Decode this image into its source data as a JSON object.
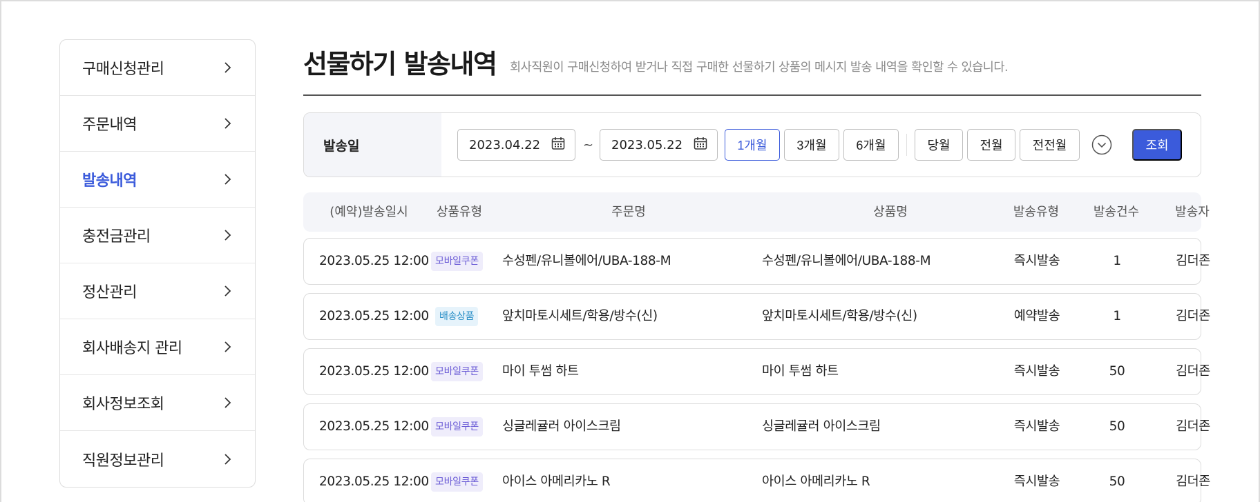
{
  "sidebar": {
    "items": [
      {
        "label": "구매신청관리",
        "active": false
      },
      {
        "label": "주문내역",
        "active": false
      },
      {
        "label": "발송내역",
        "active": true
      },
      {
        "label": "충전금관리",
        "active": false
      },
      {
        "label": "정산관리",
        "active": false
      },
      {
        "label": "회사배송지 관리",
        "active": false
      },
      {
        "label": "회사정보조회",
        "active": false
      },
      {
        "label": "직원정보관리",
        "active": false
      }
    ]
  },
  "header": {
    "title": "선물하기 발송내역",
    "description": "회사직원이 구매신청하여 받거나 직접 구매한 선물하기 상품의 메시지 발송 내역을 확인할 수 있습니다."
  },
  "filter": {
    "label": "발송일",
    "start_date": "2023.04.22",
    "tilde": "~",
    "end_date": "2023.05.22",
    "periods": [
      "1개월",
      "3개월",
      "6개월"
    ],
    "months": [
      "당월",
      "전월",
      "전전월"
    ],
    "active_period": "1개월",
    "search_label": "조회"
  },
  "table": {
    "headers": [
      "(예약)발송일시",
      "상품유형",
      "주문명",
      "상품명",
      "발송유형",
      "발송건수",
      "발송자"
    ],
    "rows": [
      {
        "datetime": "2023.05.25 12:00",
        "type": "모바일쿠폰",
        "order": "수성펜/유니볼에어/UBA-188-M",
        "product": "수성펜/유니볼에어/UBA-188-M",
        "send_type": "즉시발송",
        "count": "1",
        "sender": "김더존"
      },
      {
        "datetime": "2023.05.25 12:00",
        "type": "배송상품",
        "order": "앞치마토시세트/학용/방수(신)",
        "product": "앞치마토시세트/학용/방수(신)",
        "send_type": "예약발송",
        "count": "1",
        "sender": "김더존"
      },
      {
        "datetime": "2023.05.25 12:00",
        "type": "모바일쿠폰",
        "order": "마이 투썸 하트",
        "product": "마이 투썸 하트",
        "send_type": "즉시발송",
        "count": "50",
        "sender": "김더존"
      },
      {
        "datetime": "2023.05.25 12:00",
        "type": "모바일쿠폰",
        "order": "싱글레귤러 아이스크림",
        "product": "싱글레귤러 아이스크림",
        "send_type": "즉시발송",
        "count": "50",
        "sender": "김더존"
      },
      {
        "datetime": "2023.05.25 12:00",
        "type": "모바일쿠폰",
        "order": "아이스 아메리카노 R",
        "product": "아이스 아메리카노 R",
        "send_type": "즉시발송",
        "count": "50",
        "sender": "김더존"
      }
    ]
  },
  "colors": {
    "accent": "#3b5bdb",
    "coupon_badge_bg": "#efedfb",
    "coupon_badge_text": "#6a5bd6",
    "ship_badge_bg": "#e6f3fb",
    "ship_badge_text": "#2a8fc7"
  },
  "icons": {
    "sidebar_chevron": "chevron-right-icon",
    "date": "calendar-icon",
    "expand": "chevron-down-circle-icon"
  }
}
